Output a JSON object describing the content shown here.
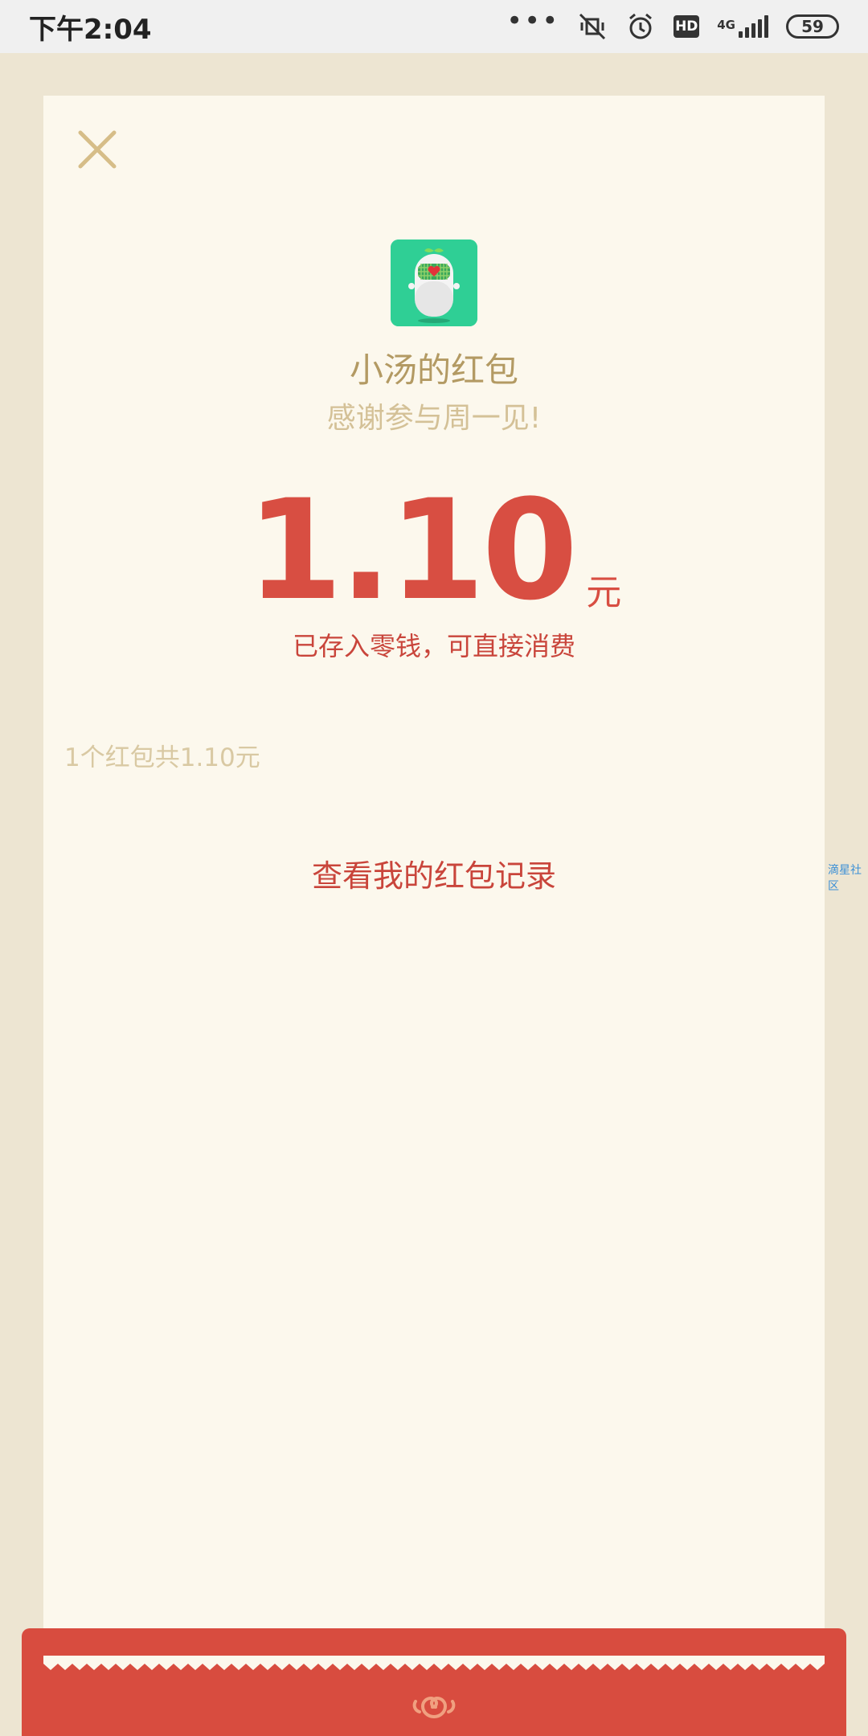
{
  "status_bar": {
    "time": "下午2:04",
    "dots": "•••",
    "hd_label": "HD",
    "network_label": "4G",
    "battery": "59"
  },
  "card": {
    "sender_title": "小汤的红包",
    "greeting": "感谢参与周一见!",
    "amount": "1.10",
    "unit": "元",
    "stored_note": "已存入零钱，可直接消费",
    "summary": "1个红包共1.10元",
    "records_link": "查看我的红包记录"
  },
  "side_link": "滴星社区",
  "colors": {
    "accent_red": "#d84e42",
    "gold_text": "#b39a63",
    "card_bg": "#fcf8ed",
    "page_bg": "#ede5d2",
    "avatar_bg": "#2fcf95"
  },
  "icons": {
    "close": "close-icon",
    "avatar": "robot-avatar",
    "envelope_logo": "swirl-cloud-icon"
  }
}
